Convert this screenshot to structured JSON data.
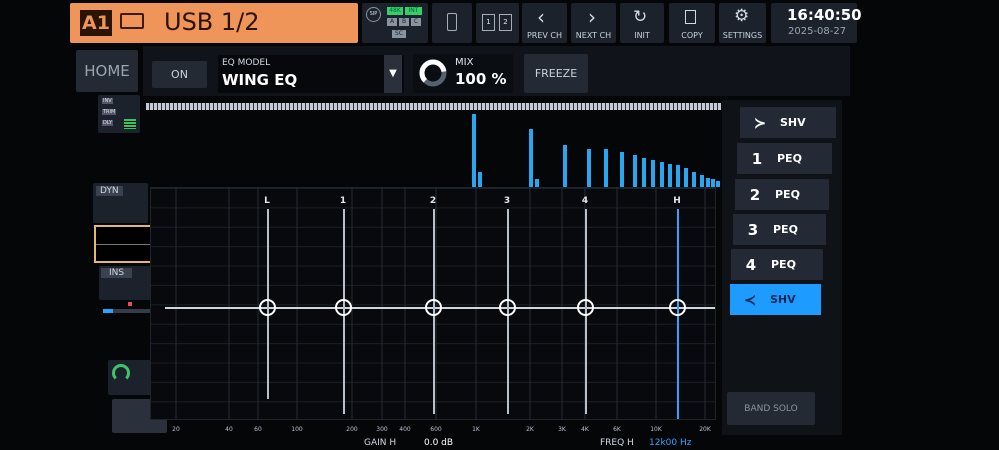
{
  "header": {
    "channel_id": "A1",
    "channel_name": "USB 1/2",
    "accent": "#f0955a"
  },
  "status": {
    "sip": "SIP",
    "rate": "48K",
    "clock_src": "INT",
    "a": "A",
    "b": "B",
    "c": "C",
    "sc": "SC"
  },
  "toolbar": {
    "prev": "PREV CH",
    "next": "NEXT CH",
    "init": "INIT",
    "copy": "COPY",
    "settings": "SETTINGS",
    "card1": "1",
    "card2": "2"
  },
  "clock": {
    "time": "16:40:50",
    "date": "2025-08-27"
  },
  "row2": {
    "home": "HOME",
    "on": "ON",
    "eq_model_label": "EQ MODEL",
    "eq_model_value": "WING EQ",
    "mix_label": "MIX",
    "mix_value": "100 %",
    "mix_fraction": 0.8,
    "freeze": "FREEZE"
  },
  "left_strip": {
    "inv": "INV",
    "trim": "TRIM",
    "dly": "DLY",
    "dyn": "DYN",
    "ins": "INS"
  },
  "graph": {
    "band_markers": [
      "L",
      "1",
      "2",
      "3",
      "4",
      "H"
    ],
    "freq_labels": [
      "20",
      "40",
      "60",
      "100",
      "200",
      "300",
      "400",
      "600",
      "1K",
      "2K",
      "3K",
      "4K",
      "6K",
      "10K",
      "20K"
    ],
    "rta_levels": [
      0.95,
      0.2,
      0.75,
      0.1,
      0.55,
      0.5,
      0.5,
      0.45,
      0.42,
      0.38,
      0.35,
      0.32,
      0.3,
      0.28,
      0.25,
      0.2,
      0.15,
      0.12,
      0.1,
      0.08
    ]
  },
  "bands": [
    {
      "num": "",
      "type": "SHV",
      "icon": "low-shelf-icon"
    },
    {
      "num": "1",
      "type": "PEQ"
    },
    {
      "num": "2",
      "type": "PEQ"
    },
    {
      "num": "3",
      "type": "PEQ"
    },
    {
      "num": "4",
      "type": "PEQ"
    },
    {
      "num": "",
      "type": "SHV",
      "icon": "high-shelf-icon",
      "active": true
    }
  ],
  "band_solo": "BAND SOLO",
  "footer": {
    "gain_label": "GAIN H",
    "gain_value": "0.0 dB",
    "freq_label": "FREQ H",
    "freq_value": "12k00 Hz"
  }
}
